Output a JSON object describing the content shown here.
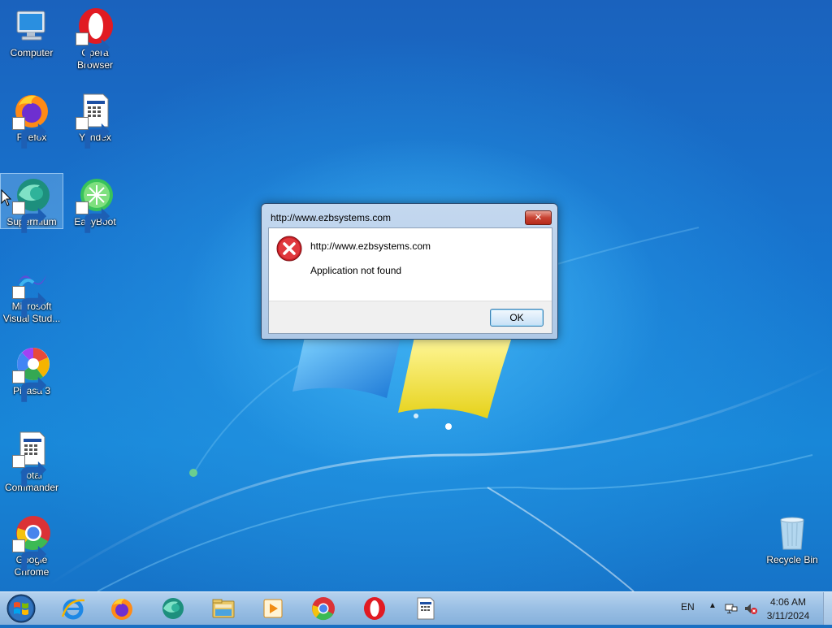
{
  "desktop": {
    "icons": [
      {
        "label": "Computer"
      },
      {
        "label": "Opera\nBrowser"
      },
      {
        "label": "Firefox"
      },
      {
        "label": "Yandex"
      },
      {
        "label": "Supermium"
      },
      {
        "label": "EasyBoot"
      },
      {
        "label": "Microsoft\nVisual Stud..."
      },
      {
        "label": "Picasa 3"
      },
      {
        "label": "Total\nCommander"
      },
      {
        "label": "Google\nChrome"
      },
      {
        "label": "Recycle Bin"
      }
    ]
  },
  "dialog": {
    "title": "http://www.ezbsystems.com",
    "close_label": "✕",
    "message_line1": "http://www.ezbsystems.com",
    "message_line2": "Application not found",
    "ok_label": "OK"
  },
  "taskbar": {
    "items": [
      "start-orb",
      "internet-explorer",
      "firefox",
      "supermium",
      "file-explorer",
      "media-player",
      "chrome",
      "opera",
      "yandex"
    ],
    "tray": {
      "language": "EN",
      "time": "4:06 AM",
      "date": "3/11/2024"
    }
  },
  "colors": {
    "desktop_bg": "#1a6fc2",
    "error_red": "#d9232b",
    "taskbar": "#a9c8e8"
  }
}
